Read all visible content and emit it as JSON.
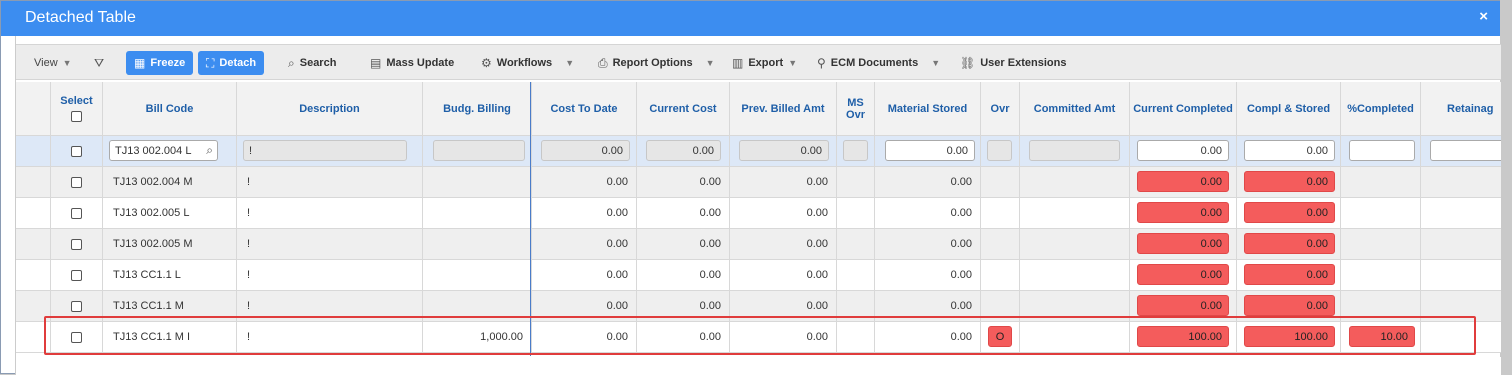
{
  "window": {
    "title": "Detached Table",
    "close_label": "×"
  },
  "toolbar": {
    "view_label": "View",
    "freeze_label": "Freeze",
    "detach_label": "Detach",
    "search_label": "Search",
    "mass_update_label": "Mass Update",
    "workflows_label": "Workflows",
    "report_options_label": "Report Options",
    "export_label": "Export",
    "ecm_documents_label": "ECM Documents",
    "user_extensions_label": "User Extensions"
  },
  "columns": {
    "select": "Select",
    "bill_code": "Bill Code",
    "description": "Description",
    "budg_billing": "Budg. Billing",
    "cost_to_date": "Cost To Date",
    "current_cost": "Current Cost",
    "prev_billed_amt": "Prev. Billed Amt",
    "ms_ovr_1": "MS",
    "ms_ovr_2": "Ovr",
    "material_stored": "Material Stored",
    "ovr": "Ovr",
    "committed_amt": "Committed Amt",
    "current_completed": "Current Completed",
    "compl_stored": "Compl & Stored",
    "pct_completed": "%Completed",
    "retainage": "Retainag"
  },
  "filter_row": {
    "bill_code": "TJ13 002.004  L",
    "description": "!",
    "cost_to_date": "0.00",
    "current_cost": "0.00",
    "prev_billed_amt": "0.00",
    "material_stored": "0.00",
    "current_completed": "0.00",
    "compl_stored": "0.00"
  },
  "rows": [
    {
      "bill_code": "TJ13 002.004  M",
      "description": "!",
      "budg_billing": "",
      "cost_to_date": "0.00",
      "current_cost": "0.00",
      "prev_billed_amt": "0.00",
      "material_stored": "0.00",
      "ovr": "",
      "current_completed": "0.00",
      "compl_stored": "0.00",
      "pct_completed": ""
    },
    {
      "bill_code": "TJ13 002.005  L",
      "description": "!",
      "budg_billing": "",
      "cost_to_date": "0.00",
      "current_cost": "0.00",
      "prev_billed_amt": "0.00",
      "material_stored": "0.00",
      "ovr": "",
      "current_completed": "0.00",
      "compl_stored": "0.00",
      "pct_completed": ""
    },
    {
      "bill_code": "TJ13 002.005  M",
      "description": "!",
      "budg_billing": "",
      "cost_to_date": "0.00",
      "current_cost": "0.00",
      "prev_billed_amt": "0.00",
      "material_stored": "0.00",
      "ovr": "",
      "current_completed": "0.00",
      "compl_stored": "0.00",
      "pct_completed": ""
    },
    {
      "bill_code": "TJ13 CC1.1    L",
      "description": "!",
      "budg_billing": "",
      "cost_to_date": "0.00",
      "current_cost": "0.00",
      "prev_billed_amt": "0.00",
      "material_stored": "0.00",
      "ovr": "",
      "current_completed": "0.00",
      "compl_stored": "0.00",
      "pct_completed": ""
    },
    {
      "bill_code": "TJ13 CC1.1    M",
      "description": "!",
      "budg_billing": "",
      "cost_to_date": "0.00",
      "current_cost": "0.00",
      "prev_billed_amt": "0.00",
      "material_stored": "0.00",
      "ovr": "",
      "current_completed": "0.00",
      "compl_stored": "0.00",
      "pct_completed": ""
    },
    {
      "bill_code": "TJ13 CC1.1    M I",
      "description": "!",
      "budg_billing": "1,000.00",
      "cost_to_date": "0.00",
      "current_cost": "0.00",
      "prev_billed_amt": "0.00",
      "material_stored": "0.00",
      "ovr": "O",
      "current_completed": "100.00",
      "compl_stored": "100.00",
      "pct_completed": "10.00"
    }
  ],
  "colors": {
    "title_bar": "#3c8df0",
    "header_text": "#1f5fa8",
    "error_fill": "#f45c5c",
    "highlight_border": "#e03c3c"
  }
}
